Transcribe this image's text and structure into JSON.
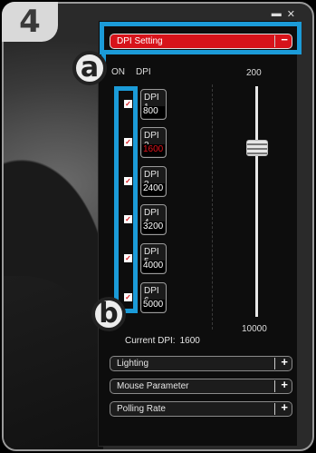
{
  "step_number": "4",
  "window": {
    "minimize_icon": "minimize-icon",
    "close_icon": "close-icon",
    "close_label": "✕"
  },
  "sections": {
    "dpi_setting": {
      "label": "DPI Setting",
      "toggle": "−"
    },
    "lighting": {
      "label": "Lighting",
      "toggle": "+"
    },
    "mouse_parameter": {
      "label": "Mouse Parameter",
      "toggle": "+"
    },
    "polling_rate": {
      "label": "Polling Rate",
      "toggle": "+"
    }
  },
  "dpi_panel": {
    "col_on": "ON",
    "col_dpi": "DPI",
    "slider_max": "200",
    "slider_min": "10000",
    "current_label": "Current DPI:",
    "current_value": "1600",
    "levels": [
      {
        "label": "DPI 1",
        "value": "800",
        "on": true,
        "selected": false
      },
      {
        "label": "DPI 2",
        "value": "1600",
        "on": true,
        "selected": true
      },
      {
        "label": "DPI 3",
        "value": "2400",
        "on": true,
        "selected": false
      },
      {
        "label": "DPI 4",
        "value": "3200",
        "on": true,
        "selected": false
      },
      {
        "label": "DPI 5",
        "value": "4000",
        "on": true,
        "selected": false
      },
      {
        "label": "DPI 6",
        "value": "5000",
        "on": true,
        "selected": false
      }
    ],
    "check_mark": "✓"
  },
  "callouts": {
    "a": "a",
    "b": "b"
  },
  "colors": {
    "accent_red": "#d7131a",
    "callout_blue": "#1b9bd8"
  }
}
